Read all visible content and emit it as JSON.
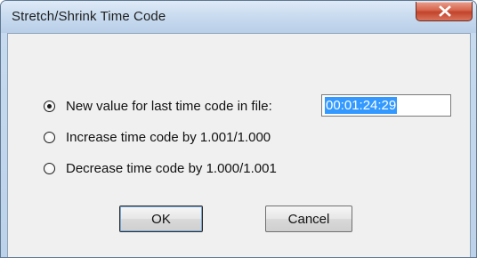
{
  "dialog": {
    "title": "Stretch/Shrink Time Code",
    "close_icon": "close-x-icon"
  },
  "options": [
    {
      "label": "New value for last time code in file:",
      "checked": true
    },
    {
      "label": "Increase time code by 1.001/1.000",
      "checked": false
    },
    {
      "label": "Decrease time code by 1.000/1.001",
      "checked": false
    }
  ],
  "timecode": {
    "value": "00:01:24:29",
    "selected": true
  },
  "buttons": {
    "ok_label": "OK",
    "cancel_label": "Cancel"
  },
  "colors": {
    "selection": "#3399ff",
    "close_button": "#c9503a",
    "title_bar": "#c6d9ee",
    "client_bg": "#f0f0f0"
  }
}
